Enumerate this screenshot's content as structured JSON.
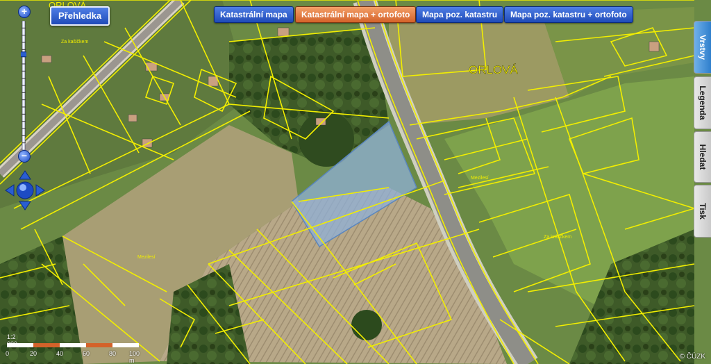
{
  "overview_button": "Přehledka",
  "map_layers": [
    {
      "label": "Katastrální mapa",
      "active": false
    },
    {
      "label": "Katastrální mapa + ortofoto",
      "active": true
    },
    {
      "label": "Mapa poz. katastru",
      "active": false
    },
    {
      "label": "Mapa poz. katastru + ortofoto",
      "active": false
    }
  ],
  "side_tabs": [
    {
      "label": "Vrstvy",
      "active": true
    },
    {
      "label": "Legenda",
      "active": false
    },
    {
      "label": "Hledat",
      "active": false
    },
    {
      "label": "Tisk",
      "active": false
    }
  ],
  "zoom": {
    "plus": "+",
    "minus": "−",
    "level_fraction": 0.25
  },
  "map_labels": {
    "town": "ORLOVÁ",
    "top": "ORLOVÁ",
    "locality_1": "Za kašičkem",
    "locality_2": "Za krásčkem",
    "locality_3": "Mezilesí",
    "locality_4": "Mezilesí"
  },
  "scale": {
    "ratio": "1:2 000",
    "ticks": [
      "0",
      "20",
      "40",
      "60",
      "80",
      "100 m"
    ]
  },
  "copyright": "© ČÚZK",
  "colors": {
    "parcel_line": "#f2ee00",
    "selected_parcel": "#7aa7d6",
    "button_blue": "#2a5ed0",
    "button_active": "#e07a3c"
  }
}
